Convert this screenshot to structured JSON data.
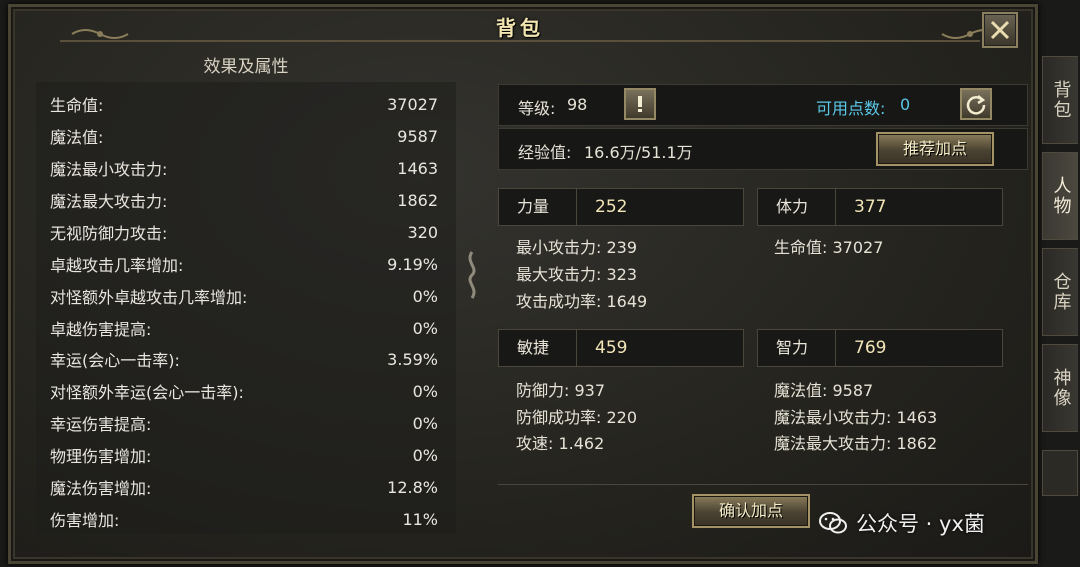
{
  "window": {
    "title": "背包",
    "close_icon": "close-icon"
  },
  "left": {
    "heading": "效果及属性",
    "stats": [
      {
        "label": "生命值:",
        "value": "37027"
      },
      {
        "label": "魔法值:",
        "value": "9587"
      },
      {
        "label": "魔法最小攻击力:",
        "value": "1463"
      },
      {
        "label": "魔法最大攻击力:",
        "value": "1862"
      },
      {
        "label": "无视防御力攻击:",
        "value": "320"
      },
      {
        "label": "卓越攻击几率增加:",
        "value": "9.19%"
      },
      {
        "label": "对怪额外卓越攻击几率增加:",
        "value": "0%"
      },
      {
        "label": "卓越伤害提高:",
        "value": "0%"
      },
      {
        "label": "幸运(会心一击率):",
        "value": "3.59%"
      },
      {
        "label": "对怪额外幸运(会心一击率):",
        "value": "0%"
      },
      {
        "label": "幸运伤害提高:",
        "value": "0%"
      },
      {
        "label": "物理伤害增加:",
        "value": "0%"
      },
      {
        "label": "魔法伤害增加:",
        "value": "12.8%"
      },
      {
        "label": "伤害增加:",
        "value": "11%"
      }
    ]
  },
  "right": {
    "level_label": "等级:",
    "level_value": "98",
    "points_label": "可用点数:",
    "points_value": "0",
    "exp_label": "经验值:",
    "exp_value": "16.6万/51.1万",
    "recommend_button": "推荐加点",
    "confirm_button": "确认加点",
    "attributes": [
      {
        "name": "力量",
        "value": "252",
        "details": [
          "最小攻击力: 239",
          "最大攻击力: 323",
          "攻击成功率: 1649"
        ]
      },
      {
        "name": "体力",
        "value": "377",
        "details": [
          "生命值: 37027"
        ]
      },
      {
        "name": "敏捷",
        "value": "459",
        "details": [
          "防御力: 937",
          "防御成功率: 220",
          "攻速: 1.462"
        ]
      },
      {
        "name": "智力",
        "value": "769",
        "details": [
          "魔法值: 9587",
          "魔法最小攻击力: 1463",
          "魔法最大攻击力: 1862"
        ]
      }
    ],
    "points_color": "#5bc8e8"
  },
  "side_tabs": [
    {
      "label": "背包"
    },
    {
      "label": "人物"
    },
    {
      "label": "仓库"
    },
    {
      "label": "神像"
    }
  ],
  "watermark": "公众号 · yx菌"
}
